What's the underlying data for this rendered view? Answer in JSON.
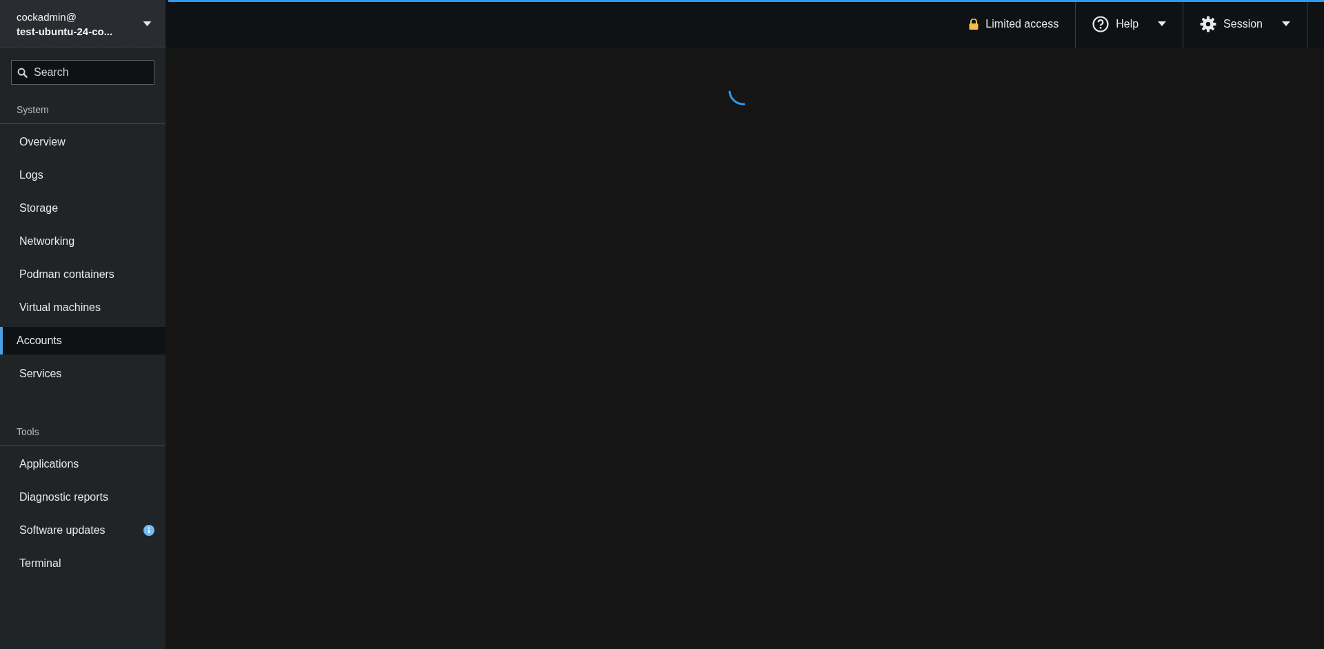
{
  "host_switcher": {
    "user": "cockadmin@",
    "host": "test-ubuntu-24-co..."
  },
  "search": {
    "placeholder": "Search"
  },
  "sections": [
    {
      "label": "System",
      "items": [
        {
          "label": "Overview",
          "selected": false,
          "notification": false
        },
        {
          "label": "Logs",
          "selected": false,
          "notification": false
        },
        {
          "label": "Storage",
          "selected": false,
          "notification": false
        },
        {
          "label": "Networking",
          "selected": false,
          "notification": false
        },
        {
          "label": "Podman containers",
          "selected": false,
          "notification": false
        },
        {
          "label": "Virtual machines",
          "selected": false,
          "notification": false
        },
        {
          "label": "Accounts",
          "selected": true,
          "notification": false
        },
        {
          "label": "Services",
          "selected": false,
          "notification": false
        }
      ]
    },
    {
      "label": "Tools",
      "items": [
        {
          "label": "Applications",
          "selected": false,
          "notification": false
        },
        {
          "label": "Diagnostic reports",
          "selected": false,
          "notification": false
        },
        {
          "label": "Software updates",
          "selected": false,
          "notification": true
        },
        {
          "label": "Terminal",
          "selected": false,
          "notification": false
        }
      ]
    }
  ],
  "header": {
    "access": "Limited access",
    "help": "Help",
    "session": "Session"
  },
  "content": {
    "loading": true
  }
}
